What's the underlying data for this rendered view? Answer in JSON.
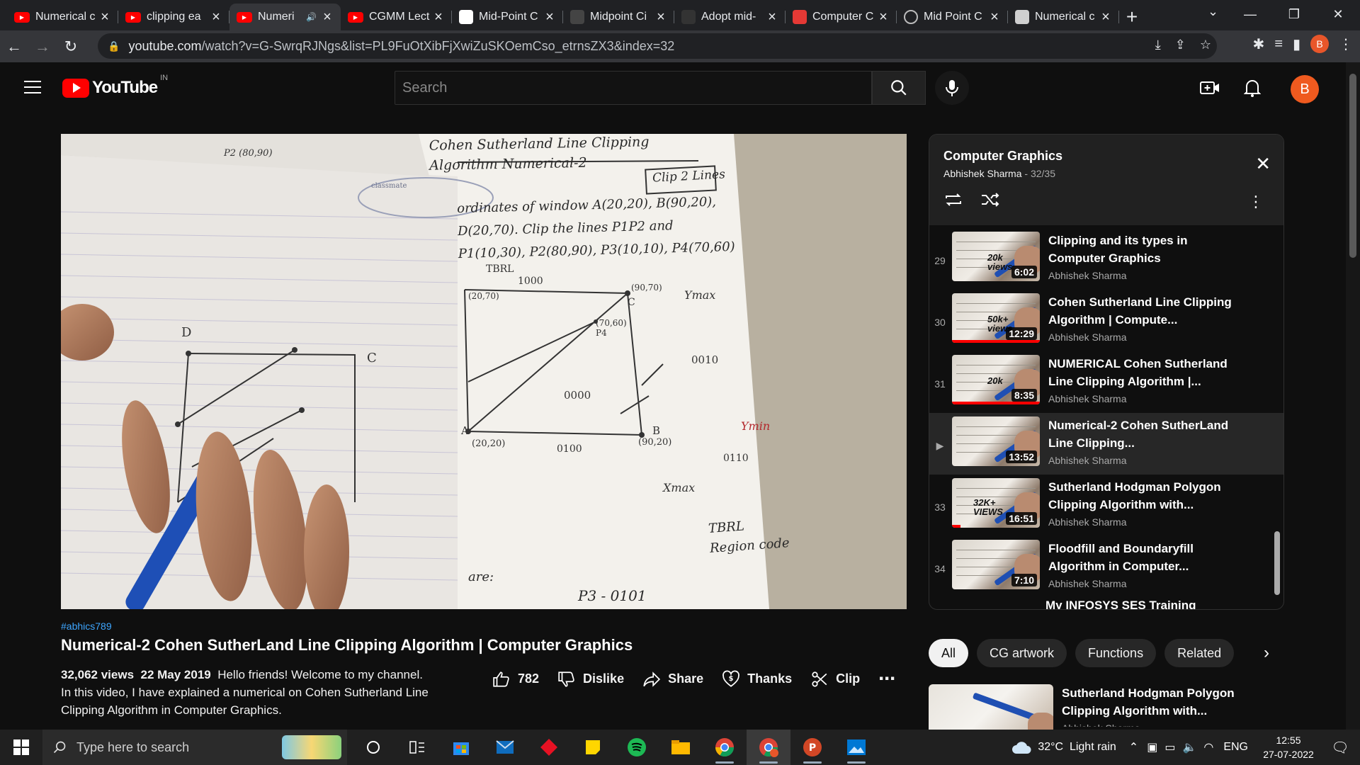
{
  "browser": {
    "tabs": [
      {
        "title": "Numerical c",
        "favicon": "youtube-icon",
        "color": "#ff0000"
      },
      {
        "title": "clipping ea",
        "favicon": "youtube-icon",
        "color": "#ff0000"
      },
      {
        "title": "Numeri",
        "favicon": "youtube-icon",
        "color": "#ff0000",
        "active": true,
        "audio": true
      },
      {
        "title": "CGMM Lect",
        "favicon": "youtube-icon",
        "color": "#ff0000"
      },
      {
        "title": "Mid-Point C",
        "favicon": "page-icon",
        "color": "#ffffff"
      },
      {
        "title": "Midpoint Ci",
        "favicon": "page-icon",
        "color": "#444444"
      },
      {
        "title": "Adopt mid-",
        "favicon": "page-icon",
        "color": "#333333"
      },
      {
        "title": "Computer C",
        "favicon": "page-icon",
        "color": "#e53935"
      },
      {
        "title": "Mid Point C",
        "favicon": "globe-icon",
        "color": "#555555"
      },
      {
        "title": "Numerical c",
        "favicon": "page-icon",
        "color": "#cfcfcf"
      }
    ],
    "url_host": "youtube.com",
    "url_path": "/watch?v=G-SwrqRJNgs&list=PL9FuOtXibFjXwiZuSKOemCso_etrnsZX3&index=32",
    "profile_initial": "B"
  },
  "youtube": {
    "logo_text": "YouTube",
    "country_code": "IN",
    "search_placeholder": "Search",
    "avatar_initial": "B"
  },
  "video": {
    "hashtag": "#abhics789",
    "title": "Numerical-2 Cohen SutherLand Line Clipping Algorithm | Computer Graphics",
    "views": "32,062 views",
    "date": "22 May 2019",
    "description_line": "Hello friends! Welcome to my channel.",
    "description_rest": "In this video, I have explained a numerical on Cohen Sutherland Line Clipping Algorithm in Computer Graphics.",
    "likes": "782",
    "dislike_label": "Dislike",
    "share_label": "Share",
    "thanks_label": "Thanks",
    "clip_label": "Clip",
    "notes": {
      "heading1": "Cohen Sutherland Line Clipping",
      "heading2": "Algorithm Numerical-2",
      "boxed": "Clip 2 Lines",
      "line1": "ordinates of window A(20,20), B(90,20),",
      "line2": "D(20,70). Clip the lines P1P2 and",
      "line3": "P1(10,30), P2(80,90), P3(10,10), P4(70,60)",
      "tbrl": "TBRL",
      "code1000": "1000",
      "code0000": "0000",
      "code0010": "0010",
      "code0100": "0100",
      "code0110": "0110",
      "ymax": "Ymax",
      "ymin": "Ymin",
      "xmax": "Xmax",
      "ptA": "A",
      "ptA_coord": "(20,20)",
      "ptB": "B",
      "ptB_coord": "(90,20)",
      "ptC": "C",
      "ptC_coord": "(90,70)",
      "ptD_coord": "(20,70)",
      "p4": "(70,60) P4",
      "p2": "P2 (80,90)",
      "region1": "TBRL",
      "region2": "Region code",
      "bottom": "P3 - 0101",
      "are": "are:",
      "left_label1": "P2 (80,90)",
      "left_label2": "D",
      "left_label3": "C",
      "classmate": "classmate"
    }
  },
  "playlist": {
    "title": "Computer Graphics",
    "channel": "Abhishek Sharma",
    "position": "32/35",
    "items": [
      {
        "index": "29",
        "title": "Clipping and its types in Computer Graphics",
        "channel": "Abhishek Sharma",
        "duration": "6:02",
        "badge": "20k views",
        "watched": 0
      },
      {
        "index": "30",
        "title": "Cohen Sutherland Line Clipping Algorithm | Compute...",
        "channel": "Abhishek Sharma",
        "duration": "12:29",
        "badge": "50k+ views",
        "watched": 1
      },
      {
        "index": "31",
        "title": "NUMERICAL Cohen Sutherland Line Clipping Algorithm |...",
        "channel": "Abhishek Sharma",
        "duration": "8:35",
        "badge": "20k",
        "watched": 1
      },
      {
        "index": "▶",
        "title": "Numerical-2 Cohen SutherLand Line Clipping...",
        "channel": "Abhishek Sharma",
        "duration": "13:52",
        "badge": "",
        "watched": 0,
        "current": true
      },
      {
        "index": "33",
        "title": "Sutherland Hodgman Polygon Clipping Algorithm with...",
        "channel": "Abhishek Sharma",
        "duration": "16:51",
        "badge": "32K+ VIEWS",
        "watched": 0.1
      },
      {
        "index": "34",
        "title": "Floodfill and Boundaryfill Algorithm in Computer...",
        "channel": "Abhishek Sharma",
        "duration": "7:10",
        "badge": "",
        "watched": 0
      }
    ],
    "partial_next": "My INFOSYS SES Training"
  },
  "chips": [
    "All",
    "CG artwork",
    "Functions",
    "Related"
  ],
  "related": {
    "title": "Sutherland Hodgman Polygon Clipping Algorithm with...",
    "channel": "Abhishek Sharma"
  },
  "taskbar": {
    "search_placeholder": "Type here to search",
    "weather": "32°C  Light rain",
    "language": "ENG",
    "time": "12:55",
    "date": "27-07-2022"
  }
}
